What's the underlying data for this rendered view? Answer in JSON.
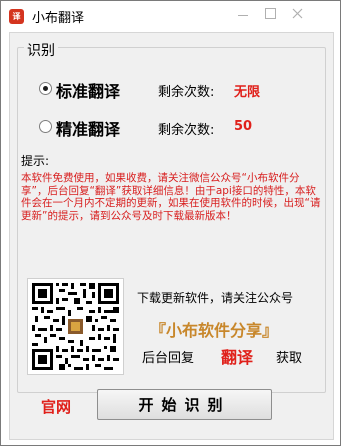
{
  "window": {
    "title": "小布翻译",
    "icon": "app-logo-icon"
  },
  "group": {
    "label": "识别"
  },
  "modes": [
    {
      "label": "标准翻译",
      "checked": true,
      "remaining_label": "剩余次数:",
      "remaining_value": "无限"
    },
    {
      "label": "精准翻译",
      "checked": false,
      "remaining_label": "剩余次数:",
      "remaining_value": "50"
    }
  ],
  "tips": {
    "label": "提示:",
    "text": "本软件免费使用，如果收费，请关注微信公众号“小布软件分享”，后台回复“翻译”获取详细信息！由于api接口的特性，本软件会在一个月内不定期的更新，如果在使用软件的时候，出现“请更新”的提示，请到公众号及时下载最新版本！"
  },
  "promo": {
    "follow_text": "下载更新软件，请关注公众号",
    "brand": "『小布软件分享』",
    "reply_prefix": "后台回复",
    "reply_keyword": "翻译",
    "reply_suffix": "获取",
    "qr_icon": "qr-code-icon"
  },
  "footer": {
    "website": "官网",
    "start_button": "开始识别"
  },
  "colors": {
    "accent_red": "#e0201a",
    "brand_gold": "#c8872b",
    "tip_red": "#d81e1e"
  }
}
